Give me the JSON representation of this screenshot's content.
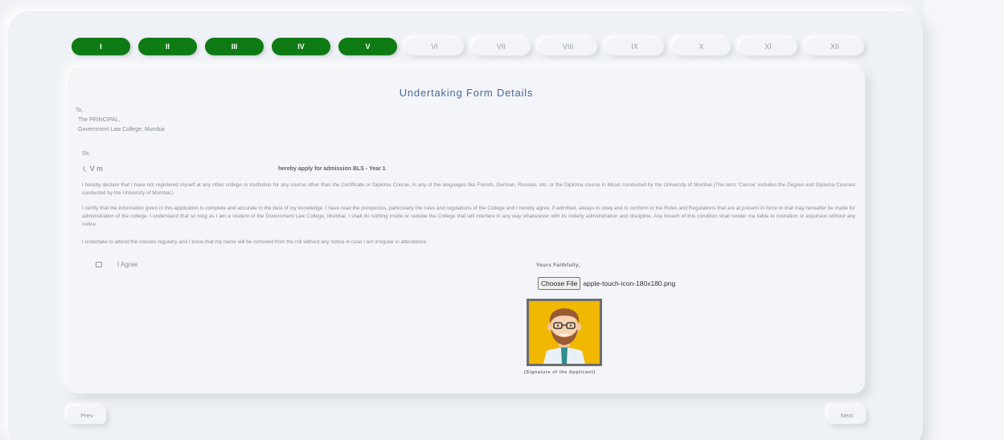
{
  "steps": [
    {
      "label": "I",
      "done": true
    },
    {
      "label": "II",
      "done": true
    },
    {
      "label": "III",
      "done": true
    },
    {
      "label": "IV",
      "done": true
    },
    {
      "label": "V",
      "done": true
    },
    {
      "label": "VI",
      "done": false
    },
    {
      "label": "VII",
      "done": false
    },
    {
      "label": "VIII",
      "done": false
    },
    {
      "label": "IX",
      "done": false
    },
    {
      "label": "X",
      "done": false
    },
    {
      "label": "XI",
      "done": false
    },
    {
      "label": "XII",
      "done": false
    }
  ],
  "form": {
    "title": "Undertaking Form Details",
    "address": {
      "to": "To,",
      "line1": "The PRINCIPAL,",
      "line2": "Government Law College, Mumbai"
    },
    "salutation": "Sir,",
    "name_prefix": "I,",
    "applicant_name": "V m",
    "apply_text": "hereby apply for admission BLS - Year 1",
    "para1": "I hereby declare that I have not registered myself at any other college or institution for any course other than the Certificate or Diploma Course, in any of the languages like French, German, Russian, etc. or the Diploma course in Music conducted by the University of Mumbai (The term 'Course' includes the Degree and Diploma Courses conducted by the University of Mumbai.)",
    "para2": "I certify that the information given in this application is complete and accurate to the best of my knowledge. I have read the prospectus, particularly the rules and regulations of the College and I hereby agree, if admitted, always to obey and to conform to the Rules and Regulations that are at present in force or that may hereafter be made for administration of the college. I understand that so long as I am a student of the Government Law College, Mumbai. I shall do nothing inside or outside the College that will interfere in any way whatsoever with its orderly administration and discipline. Any breach of this condition shall render me liable to rustration or expulsion without any notice.",
    "para3": "I undertake to attend the classes regularly and I know that my name will be removed from the roll without any notice in case I am irregular in attendance.",
    "agree_label": "I Agree",
    "faithfully": "Yours Faithfully,",
    "choose_file_label": "Choose File",
    "file_name": "apple-touch-icon-180x180.png",
    "signature_caption": "(Signature of the Applicant)"
  },
  "nav": {
    "prev": "Prev",
    "next": "Next"
  },
  "colors": {
    "step_done": "#0e7a13",
    "title": "#4a6a9a",
    "background": "#eef1f5"
  }
}
